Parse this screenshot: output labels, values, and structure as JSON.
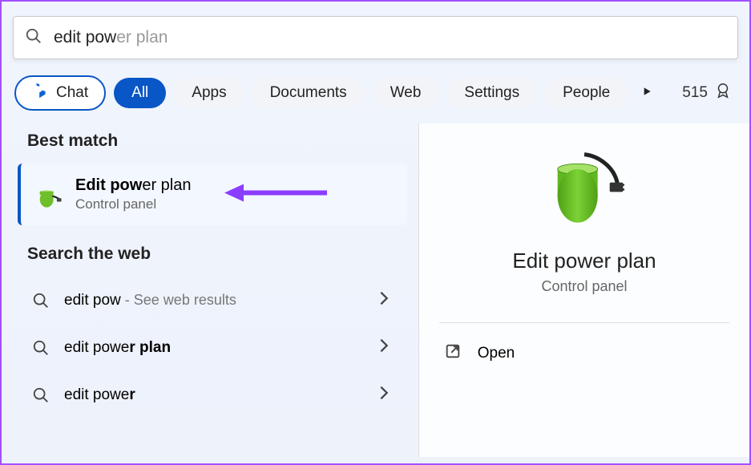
{
  "search": {
    "typed": "edit pow",
    "completion": "er plan"
  },
  "filters": {
    "chat": "Chat",
    "all": "All",
    "apps": "Apps",
    "documents": "Documents",
    "web": "Web",
    "settings": "Settings",
    "people": "People"
  },
  "rewards": {
    "count": "515"
  },
  "sections": {
    "best_match": "Best match",
    "search_web": "Search the web"
  },
  "best_match": {
    "title_bold": "Edit pow",
    "title_rest": "er plan",
    "subtitle": "Control panel"
  },
  "web_results": [
    {
      "bold_lead": "",
      "text": "edit pow",
      "bold_trail": "",
      "suffix": " - See web results"
    },
    {
      "bold_lead": "",
      "text": "edit powe",
      "bold_trail": "r plan",
      "suffix": ""
    },
    {
      "bold_lead": "",
      "text": "edit powe",
      "bold_trail": "r",
      "suffix": ""
    }
  ],
  "preview": {
    "title": "Edit power plan",
    "subtitle": "Control panel",
    "open": "Open"
  }
}
